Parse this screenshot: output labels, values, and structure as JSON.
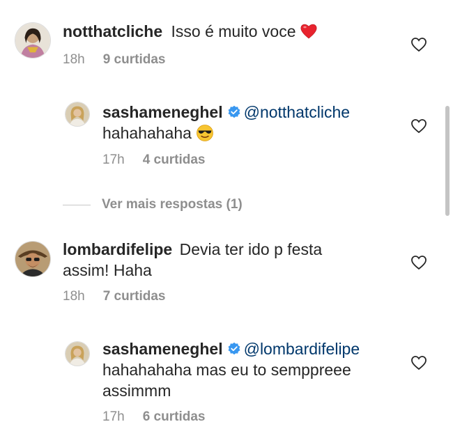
{
  "comments": [
    {
      "username": "notthatcliche",
      "text": "Isso é muito voce",
      "emoji": "red-heart",
      "time": "18h",
      "likes": "9 curtidas"
    },
    {
      "username": "sashameneghel",
      "mention": "@notthatcliche",
      "text": "hahahahaha",
      "emoji": "sunglasses-face",
      "time": "17h",
      "likes": "4 curtidas"
    },
    {
      "username": "lombardifelipe",
      "text_line1": "Devia ter ido p festa",
      "text_line2": "assim! Haha",
      "time": "18h",
      "likes": "7 curtidas"
    },
    {
      "username": "sashameneghel",
      "mention": "@lombardifelipe",
      "text_line1": "hahahahaha mas eu to semppreee",
      "text_line2": "assimmm",
      "time": "17h",
      "likes": "6 curtidas"
    }
  ],
  "view_more_replies": "Ver mais respostas (1)",
  "colors": {
    "text": "#262626",
    "meta": "#8e8e8e",
    "mention": "#00376b",
    "verified": "#3897f0"
  },
  "icons": [
    "heart-outline-icon",
    "verified-badge-icon",
    "red-heart-emoji",
    "sunglasses-face-emoji"
  ]
}
